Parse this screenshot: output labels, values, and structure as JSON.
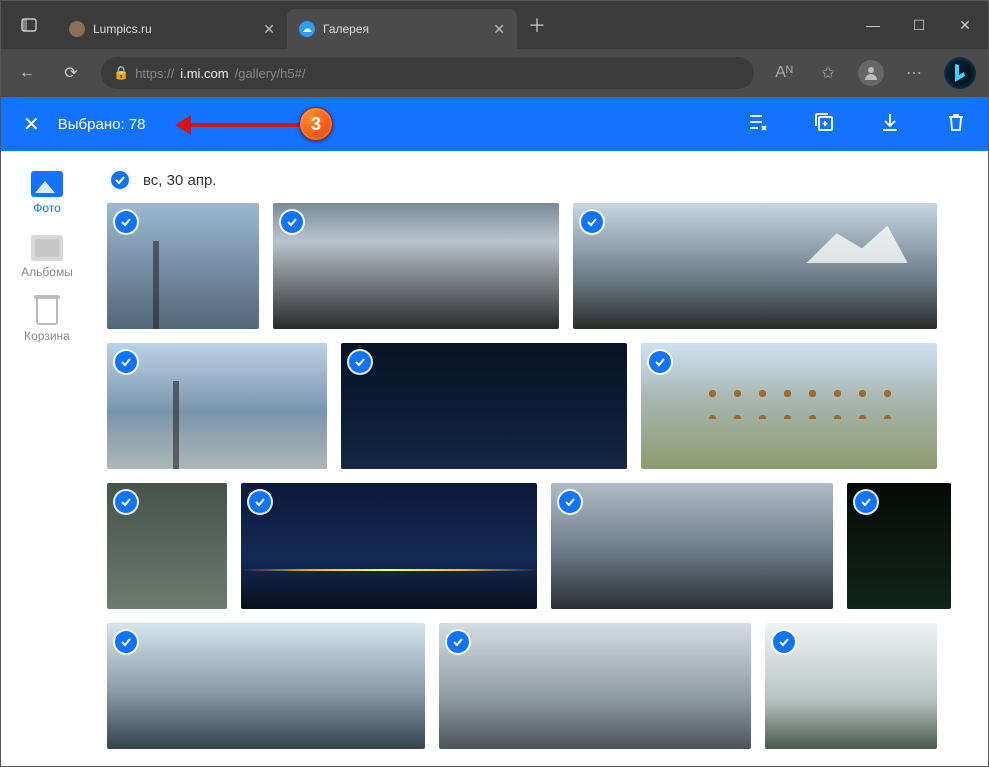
{
  "browser": {
    "tabs": [
      {
        "title": "Lumpics.ru",
        "favicon_bg": "#8c6d57",
        "active": false
      },
      {
        "title": "Галерея",
        "favicon_bg": "#2a9df4",
        "active": true
      }
    ],
    "url_protocol": "https://",
    "url_host": "i.mi.com",
    "url_path": "/gallery/h5#/"
  },
  "selection": {
    "label": "Выбрано: 78"
  },
  "annotation": {
    "step": "3"
  },
  "sidebar": {
    "items": [
      {
        "label": "Фото",
        "icon": "photo",
        "active": true
      },
      {
        "label": "Альбомы",
        "icon": "album",
        "active": false
      },
      {
        "label": "Корзина",
        "icon": "trash",
        "active": false
      }
    ]
  },
  "date_group": {
    "label": "вс, 30 апр."
  },
  "icons": {
    "close_x": "✕",
    "plus": "＋",
    "minimize": "—",
    "maximize": "☐",
    "win_close": "✕",
    "back": "←",
    "refresh": "⟳",
    "lock": "🔒",
    "read": "Aᴺ",
    "fav": "✩",
    "more": "⋯",
    "remove_list": "≡✕",
    "add_album": "⧉",
    "download": "⭳",
    "trash": "🗑"
  }
}
